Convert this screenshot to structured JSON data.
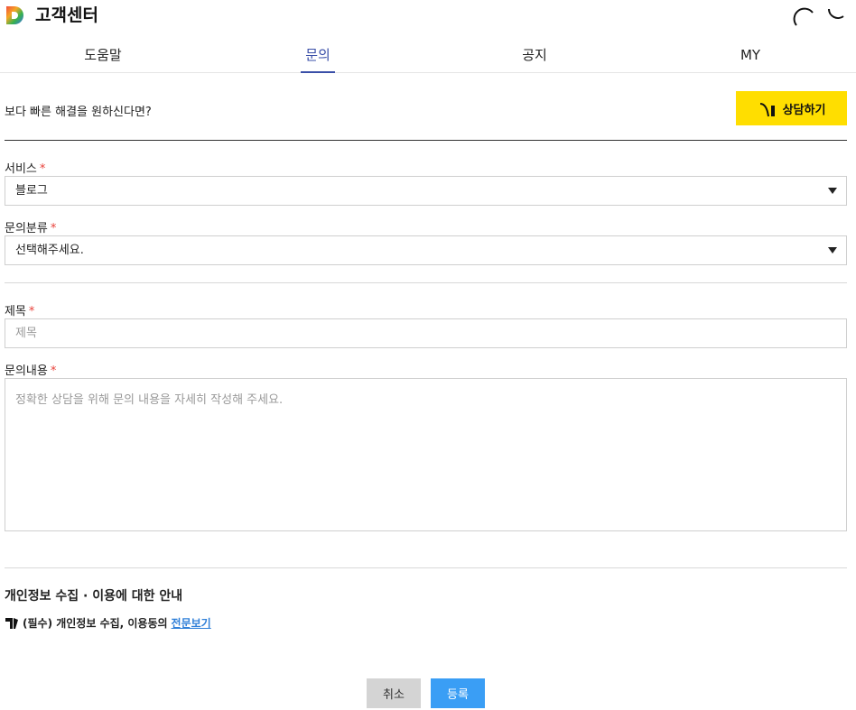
{
  "header": {
    "title": "고객센터",
    "icons": [
      "daum-logo-icon",
      "loading-arc-icon",
      "loading-arc-icon"
    ]
  },
  "tabs": [
    {
      "label": "도움말",
      "active": false
    },
    {
      "label": "문의",
      "active": true
    },
    {
      "label": "공지",
      "active": false
    },
    {
      "label": "MY",
      "active": false
    }
  ],
  "promo": {
    "text": "보다 빠른 해결을 원하신다면?",
    "button_label": "상담하기",
    "button_color": "#ffde00"
  },
  "form": {
    "service": {
      "label": "서비스",
      "required_mark": "*",
      "value": "블로그"
    },
    "category": {
      "label": "문의분류",
      "required_mark": "*",
      "value": "선택해주세요."
    },
    "subject": {
      "label": "제목",
      "required_mark": "*",
      "placeholder": "제목"
    },
    "content": {
      "label": "문의내용",
      "required_mark": "*",
      "placeholder": "정확한 상담을 위해 문의 내용을 자세히 작성해 주세요."
    }
  },
  "privacy": {
    "title": "개인정보 수집 · 이용에 대한 안내",
    "consent_text": "(필수) 개인정보 수집, 이용동의",
    "link_text": "전문보기"
  },
  "actions": {
    "cancel_label": "취소",
    "submit_label": "등록",
    "accent_color": "#3a9ef5"
  }
}
